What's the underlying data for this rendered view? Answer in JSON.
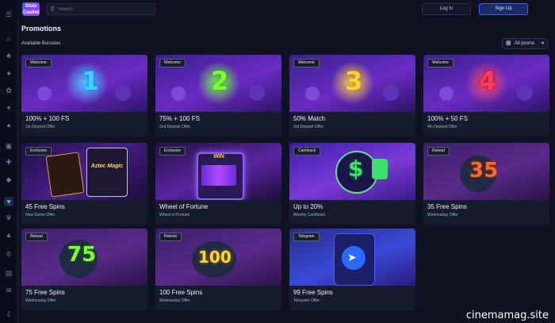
{
  "header": {
    "logo_text": "Slots Casino",
    "search_placeholder": "Search",
    "login_label": "Log In",
    "signup_label": "Sign Up"
  },
  "page": {
    "title": "Promotions",
    "subtitle": "Available Bonuses",
    "filter_label": "All promo"
  },
  "cards": [
    {
      "tag": "Welcome",
      "title": "100% + 100 FS",
      "subtitle": "1st Deposit Offer",
      "art_label": "1"
    },
    {
      "tag": "Welcome",
      "title": "75% + 100 FS",
      "subtitle": "2nd Deposit Offer",
      "art_label": "2"
    },
    {
      "tag": "Welcome",
      "title": "50% Match",
      "subtitle": "3rd Deposit Offer",
      "art_label": "3"
    },
    {
      "tag": "Welcome",
      "title": "100% + 50 FS",
      "subtitle": "4th Deposit Offer",
      "art_label": "4"
    },
    {
      "tag": "Exclusive",
      "title": "45 Free Spins",
      "subtitle": "New Game Offer",
      "art_label": "Aztec Magic"
    },
    {
      "tag": "Exclusive",
      "title": "Wheel of Fortune",
      "subtitle": "Wheel of Fortune",
      "art_label": "WIN"
    },
    {
      "tag": "Cashback",
      "title": "Up to 20%",
      "subtitle": "Weekly Cashback",
      "art_label": "$"
    },
    {
      "tag": "Reload",
      "title": "35 Free Spins",
      "subtitle": "Wednesday Offer",
      "art_label": "35"
    },
    {
      "tag": "Reload",
      "title": "75 Free Spins",
      "subtitle": "Wednesday Offer",
      "art_label": "75"
    },
    {
      "tag": "Reload",
      "title": "100 Free Spins",
      "subtitle": "Wednesday Offer",
      "art_label": "100"
    },
    {
      "tag": "Telegram",
      "title": "99 Free Spins",
      "subtitle": "Telegram Offer",
      "art_label": ""
    }
  ],
  "sidebar_icons": [
    "home-icon",
    "slots-icon",
    "casino-icon",
    "cherry-icon",
    "jackpot-icon",
    "live-icon",
    "table-icon",
    "bonus-icon",
    "gift-icon",
    "trophy-icon",
    "rocket-icon",
    "crown-icon",
    "wallet-icon",
    "chat-icon",
    "download-icon"
  ],
  "watermark": "cinemamag.site",
  "colors": {
    "accent": "#3d63ff",
    "background": "#0e1221",
    "card": "#161b2e"
  }
}
